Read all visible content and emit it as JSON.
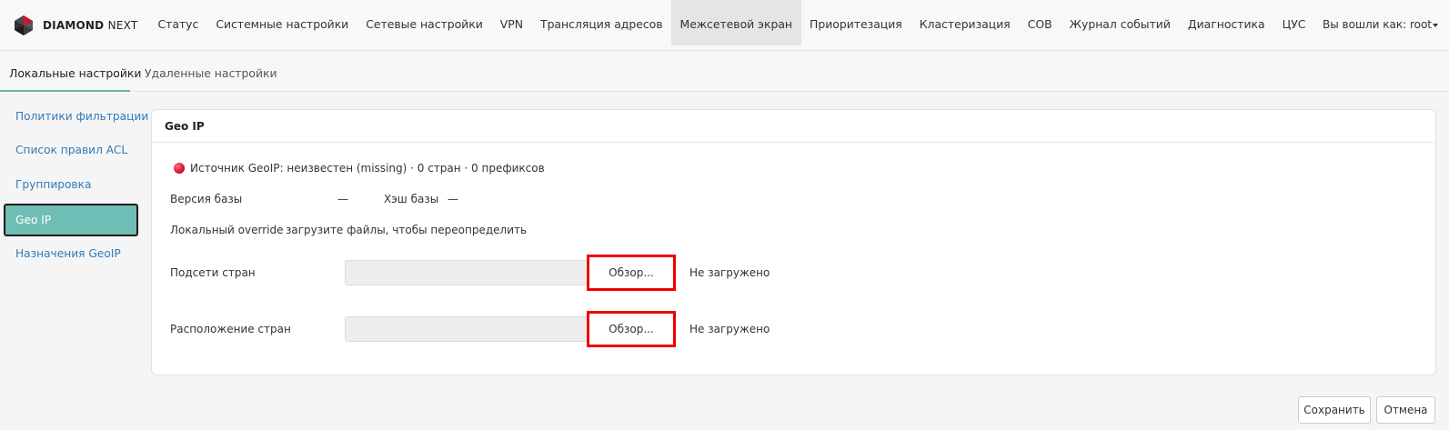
{
  "header": {
    "brand_bold": "DIAMOND",
    "brand_light": "NEXT",
    "nav": [
      {
        "label": "Статус",
        "active": false
      },
      {
        "label": "Системные настройки",
        "active": false
      },
      {
        "label": "Сетевые настройки",
        "active": false
      },
      {
        "label": "VPN",
        "active": false
      },
      {
        "label": "Трансляция адресов",
        "active": false
      },
      {
        "label": "Межсетевой экран",
        "active": true
      },
      {
        "label": "Приоритезация",
        "active": false
      },
      {
        "label": "Кластеризация",
        "active": false
      },
      {
        "label": "СОВ",
        "active": false
      },
      {
        "label": "Журнал событий",
        "active": false
      },
      {
        "label": "Диагностика",
        "active": false
      },
      {
        "label": "ЦУС",
        "active": false
      }
    ],
    "user_label": "Вы вошли как: root"
  },
  "subtabs": {
    "local": "Локальные настройки",
    "remote": "Удаленные настройки"
  },
  "sidebar": {
    "items": [
      {
        "label": "Политики фильтрации",
        "active": false
      },
      {
        "label": "Список правил ACL",
        "active": false
      },
      {
        "label": "Группировка",
        "active": false
      },
      {
        "label": "Geo IP",
        "active": true
      },
      {
        "label": "Назначения GeoIP",
        "active": false
      }
    ]
  },
  "panel": {
    "title": "Geo IP",
    "status_text": "Источник GeoIP: неизвестен (missing) · 0 стран · 0 префиксов",
    "status_color": "#d8102e",
    "db_version_label": "Версия базы",
    "db_version_value": "—",
    "db_hash_label": "Хэш базы",
    "db_hash_value": "—",
    "override_label": "Локальный override",
    "override_value": "загрузите файлы, чтобы переопределить",
    "subnets_label": "Подсети стран",
    "subnets_input_value": "",
    "subnets_browse": "Обзор...",
    "subnets_status": "Не загружено",
    "locations_label": "Расположение стран",
    "locations_input_value": "",
    "locations_browse": "Обзор...",
    "locations_status": "Не загружено"
  },
  "footer": {
    "save": "Сохранить",
    "cancel": "Отмена"
  },
  "colors": {
    "accent": "#6fbeb5",
    "link": "#337ab7",
    "highlight": "#e00000"
  }
}
